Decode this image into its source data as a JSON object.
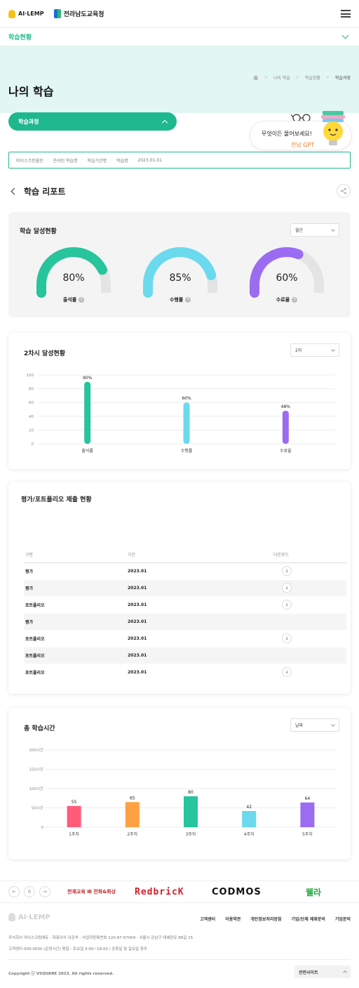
{
  "header": {
    "logo_ai": "AI·LEMP",
    "logo_edu": "전라남도교육청",
    "menu_icon": "hamburger-icon"
  },
  "subnav": {
    "label": "학습현황",
    "icon": "chevron-down-icon"
  },
  "hero": {
    "title": "나의 학습",
    "breadcrumb": [
      "나의 학습",
      "학습현황",
      "학습과정"
    ]
  },
  "course_button": {
    "label": "학습과정"
  },
  "gpt": {
    "question": "무엇이든 물어보세요!",
    "name": "전남 GPT"
  },
  "filter": [
    "마이스크린올인",
    "온라인 학습명",
    "학습기간명",
    "학습명",
    "2023.01.01"
  ],
  "report": {
    "title": "학습 리포트"
  },
  "achievement": {
    "title": "학습 달성현황",
    "select": "월간",
    "gauges": [
      {
        "value": "80%",
        "label": "출석률",
        "fraction": 0.8,
        "color": "#28c49c"
      },
      {
        "value": "85%",
        "label": "수행률",
        "fraction": 0.85,
        "color": "#6bd9ee"
      },
      {
        "value": "60%",
        "label": "수료율",
        "fraction": 0.6,
        "color": "#9b6cf2"
      }
    ]
  },
  "second": {
    "title": "2차시 달성현황",
    "select": "2차",
    "chart_data": {
      "type": "bar",
      "categories": [
        "출석률",
        "수행률",
        "수료율"
      ],
      "values": [
        90,
        60,
        48
      ],
      "value_labels": [
        "90%",
        "60%",
        "48%"
      ],
      "colors": [
        "#28c49c",
        "#6bd9ee",
        "#9b6cf2"
      ],
      "yticks": [
        "100",
        "80",
        "60",
        "40",
        "20",
        "0"
      ],
      "ylim": [
        0,
        100
      ]
    }
  },
  "portfolio": {
    "title": "평가/포트폴리오 제출 현황",
    "headers": [
      "구분",
      "기간",
      "다운로드"
    ],
    "rows": [
      {
        "type": "평가",
        "period": "2023.01",
        "download": true
      },
      {
        "type": "평가",
        "period": "2023.01",
        "download": true
      },
      {
        "type": "포트폴리오",
        "period": "2023.01",
        "download": true
      },
      {
        "type": "평가",
        "period": "2023.01",
        "download": false
      },
      {
        "type": "포트폴리오",
        "period": "2023.01",
        "download": true
      },
      {
        "type": "포트폴리오",
        "period": "2023.01",
        "download": false
      },
      {
        "type": "포트폴리오",
        "period": "2023.01",
        "download": true
      }
    ]
  },
  "study_time": {
    "title": "총 학습시간",
    "select": "날짜",
    "chart_data": {
      "type": "bar",
      "categories": [
        "1주차",
        "2주차",
        "3주차",
        "4주차",
        "5주차"
      ],
      "values": [
        55,
        65,
        80,
        42,
        64
      ],
      "value_labels": [
        "55",
        "65",
        "80",
        "42",
        "64"
      ],
      "colors": [
        "#ff5c7a",
        "#ffa043",
        "#28c49c",
        "#6bd9ee",
        "#9b6cf2"
      ],
      "yticks": [
        "200시간",
        "150시간",
        "100시간",
        "50시간",
        "0"
      ],
      "ylim": [
        0,
        200
      ]
    }
  },
  "partners": {
    "nav": [
      "←",
      "II",
      "→"
    ],
    "items": [
      "천재교육 Ⅲ 전화&화상",
      "RedbricK",
      "CODMOS",
      "웰라"
    ]
  },
  "footer": {
    "logo": "AI·LEMP",
    "links": [
      "고객센터",
      "이용약관",
      "개인정보처리방침",
      "기업/단체 제휴문의",
      "기업문의"
    ],
    "info_line1": "주식회사 아이스크림에듀 · 대표이사 이운석 · 사업자등록번호 120-87-97004 · 서울시 강남구 테헤란로 88길 15",
    "info_line2": "고객센터 000-0000 (운영시간) 평일 - 토요일 9:00~18:00 / 공휴일 및 일요일 휴무",
    "copyright": "Copyright ⓒ VSQUARE 2023. All rights reserved.",
    "related": "관련사이트"
  }
}
